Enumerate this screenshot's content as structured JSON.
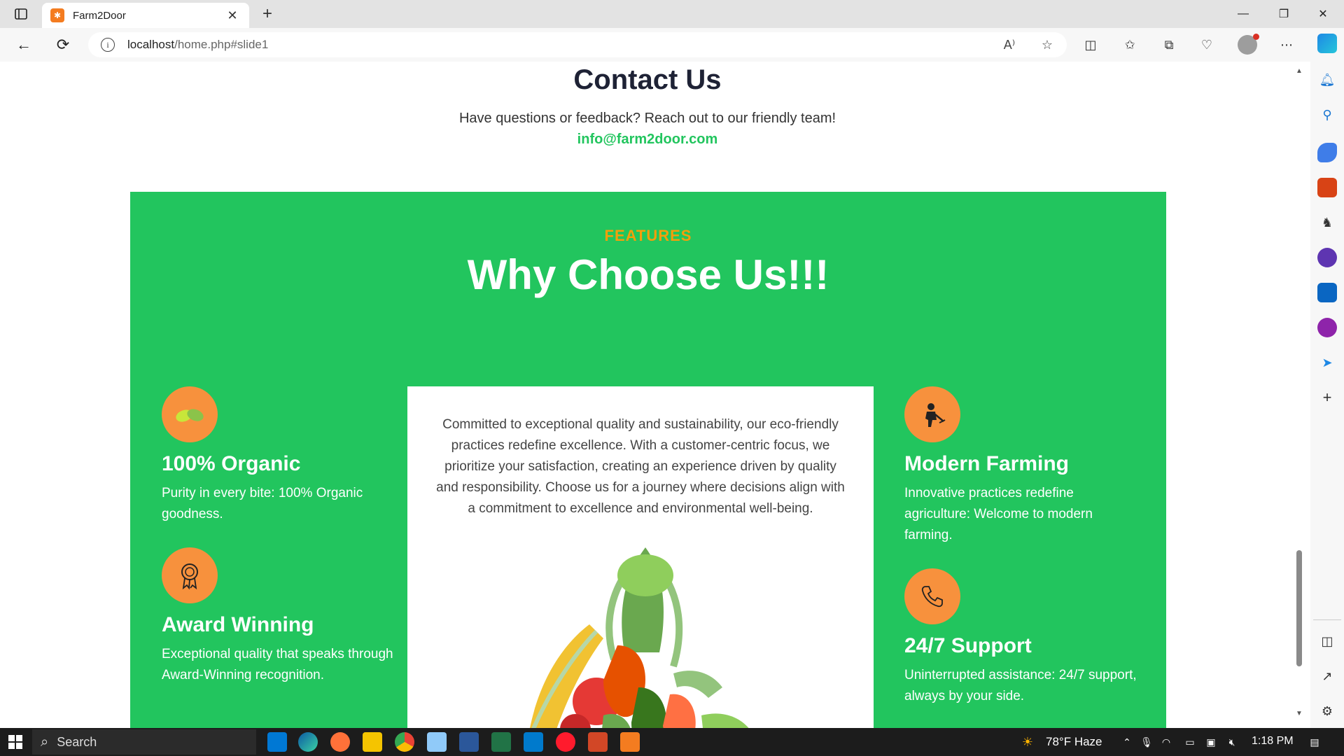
{
  "browser": {
    "tab_title": "Farm2Door",
    "url_host": "localhost",
    "url_path": "/home.php#slide1"
  },
  "contact": {
    "title": "Contact Us",
    "subtitle": "Have questions or feedback? Reach out to our friendly team!",
    "email": "info@farm2door.com"
  },
  "features": {
    "eyebrow": "FEATURES",
    "heading": "Why Choose Us!!!",
    "items": [
      {
        "title": "100% Organic",
        "desc": "Purity in every bite: 100% Organic goodness.",
        "icon": "leaf-icon"
      },
      {
        "title": "Award Winning",
        "desc": "Exceptional quality that speaks through Award-Winning recognition.",
        "icon": "award-icon"
      },
      {
        "title": "Modern Farming",
        "desc": "Innovative practices redefine agriculture: Welcome to modern farming.",
        "icon": "farmer-icon"
      },
      {
        "title": "24/7 Support",
        "desc": "Uninterrupted assistance: 24/7 support, always by your side.",
        "icon": "phone-icon"
      }
    ],
    "center_text": "Committed to exceptional quality and sustainability, our eco-friendly practices redefine excellence. With a customer-centric focus, we prioritize your satisfaction, creating an experience driven by quality and responsibility. Choose us for a journey where decisions align with a commitment to excellence and environmental well-being."
  },
  "taskbar": {
    "search_label": "Search",
    "weather": "78°F  Haze",
    "time": "1:18 PM"
  },
  "colors": {
    "brand_green": "#22c55e",
    "accent_orange": "#f7913d",
    "eyebrow_orange": "#f59e0b",
    "heading_dark": "#1e2235"
  }
}
